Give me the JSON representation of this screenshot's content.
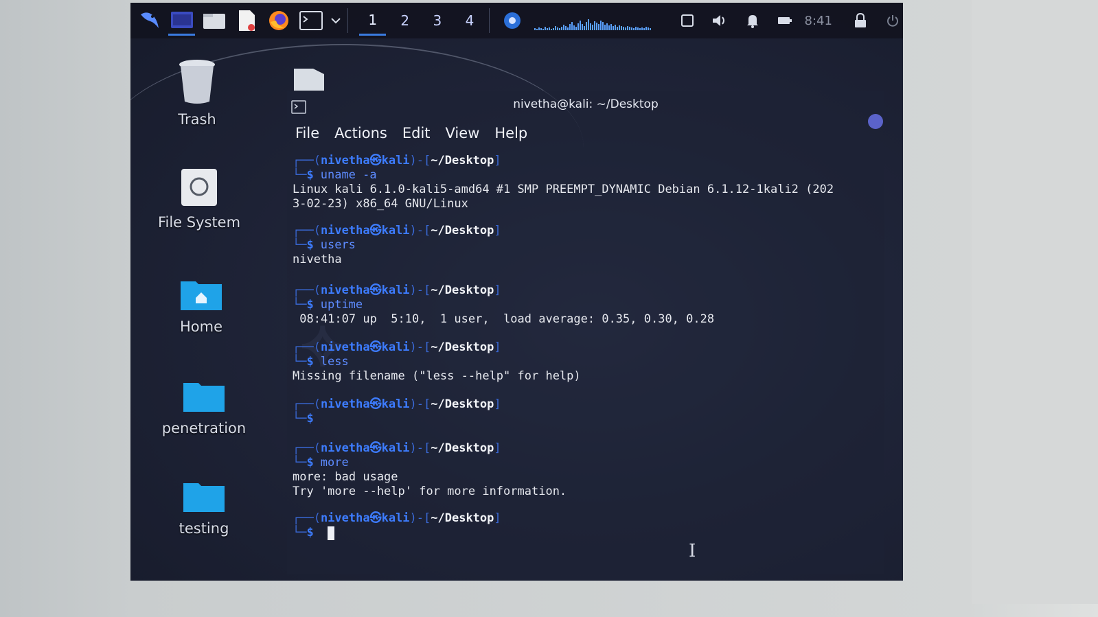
{
  "panel": {
    "workspaces": [
      "1",
      "2",
      "3",
      "4"
    ],
    "active_workspace": "1",
    "clock": "8:41",
    "icons": [
      "kali-menu-icon",
      "terminal-window-icon",
      "file-manager-icon",
      "text-editor-icon",
      "firefox-icon",
      "terminal-launcher-icon",
      "dropdown-icon",
      "network-monitor-icon",
      "screenshot-icon",
      "volume-icon",
      "notifications-icon",
      "battery-icon",
      "lock-icon",
      "power-icon"
    ]
  },
  "desktop": {
    "icons": [
      {
        "label": "Trash",
        "icon": "trash-icon"
      },
      {
        "label": "File System",
        "icon": "drive-icon"
      },
      {
        "label": "Home",
        "icon": "home-folder-icon"
      },
      {
        "label": "penetration",
        "icon": "folder-icon"
      },
      {
        "label": "testing",
        "icon": "folder-icon"
      }
    ]
  },
  "terminal": {
    "title": "nivetha@kali: ~/Desktop",
    "menu": [
      "File",
      "Actions",
      "Edit",
      "View",
      "Help"
    ],
    "prompt_user": "nivetha㉿kali",
    "prompt_path": "~/Desktop",
    "sessions": [
      {
        "cmd": "uname -a",
        "output": "Linux kali 6.1.0-kali5-amd64 #1 SMP PREEMPT_DYNAMIC Debian 6.1.12-1kali2 (202\n3-02-23) x86_64 GNU/Linux"
      },
      {
        "cmd": "users",
        "output": "nivetha"
      },
      {
        "cmd": "uptime",
        "output": " 08:41:07 up  5:10,  1 user,  load average: 0.35, 0.30, 0.28"
      },
      {
        "cmd": "less",
        "output": "Missing filename (\"less --help\" for help)"
      },
      {
        "cmd": "",
        "output": ""
      },
      {
        "cmd": "more",
        "output": "more: bad usage\nTry 'more --help' for more information."
      }
    ],
    "current_cmd": ""
  },
  "colors": {
    "accent": "#3d7cff",
    "panel": "#12141f",
    "desktop": "#1f2438"
  }
}
